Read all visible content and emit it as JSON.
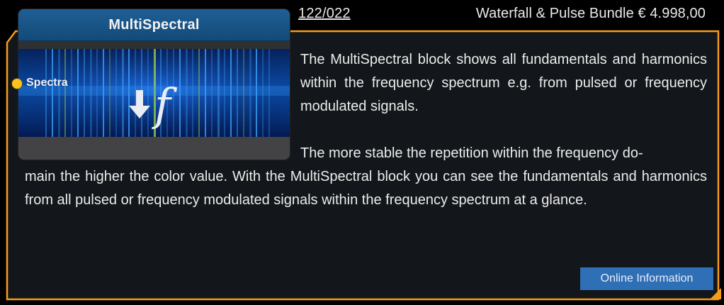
{
  "header": {
    "code": "122/022",
    "bundle": "Waterfall & Pulse Bundle € 4.998,00"
  },
  "block": {
    "title": "MultiSpectral",
    "port_label": "Spectra",
    "port_color": "#ffc21a",
    "header_color": "#1a5a8e",
    "icon": "arrow-down-frequency-icon",
    "icon_glyph": "↓f"
  },
  "description": {
    "top": "The MultiSpectral block shows all fundamentals and harmonics within the frequency spectrum e.g. from pulsed or frequency modulated signals.",
    "bottom_lead": "The more stable the repetition within the frequency do-",
    "bottom_rest": "main the higher the color value. With the MultiSpectral block you can see the fundamentals and harmonics from all pulsed or frequency modulated signals within the frequency spectrum at a glance."
  },
  "actions": {
    "online_info_label": "Online Information"
  },
  "colors": {
    "frame": "#f59c1a",
    "panel": "#13161a",
    "button": "#2f6fb6"
  }
}
